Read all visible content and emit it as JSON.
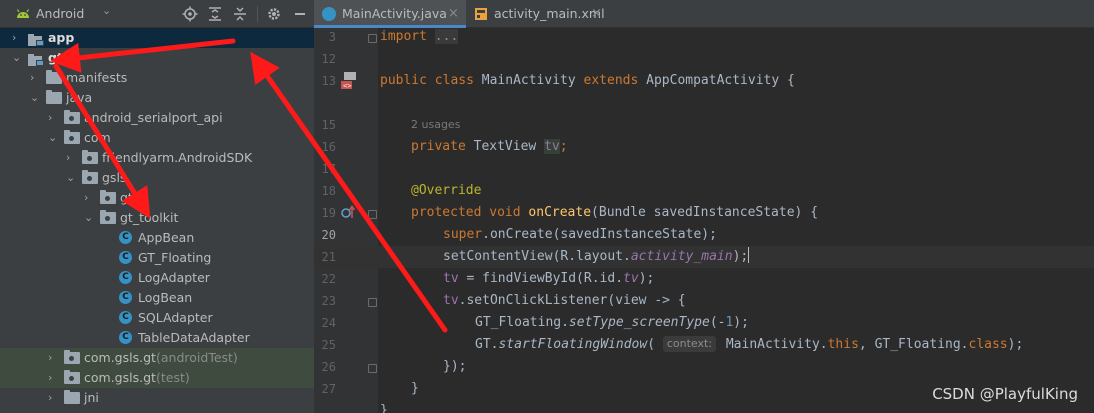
{
  "project_panel": {
    "view_name": "Android",
    "tree": [
      {
        "label": "app",
        "bold": true,
        "arrow": "›",
        "indent": 0,
        "icon": "module-icon",
        "selected": true
      },
      {
        "label": "gt",
        "bold": true,
        "arrow": "⌄",
        "indent": 0,
        "icon": "module-icon"
      },
      {
        "label": "manifests",
        "arrow": "›",
        "indent": 1,
        "icon": "folder-icon"
      },
      {
        "label": "java",
        "arrow": "⌄",
        "indent": 1,
        "icon": "folder-icon"
      },
      {
        "label": "android_serialport_api",
        "arrow": "›",
        "indent": 2,
        "icon": "package-icon"
      },
      {
        "label": "com",
        "arrow": "⌄",
        "indent": 2,
        "icon": "package-icon"
      },
      {
        "label": "friendlyarm.AndroidSDK",
        "arrow": "›",
        "indent": 3,
        "icon": "package-icon"
      },
      {
        "label": "gsls",
        "arrow": "⌄",
        "indent": 3,
        "icon": "package-icon"
      },
      {
        "label": "gt",
        "arrow": "›",
        "indent": 4,
        "icon": "package-icon"
      },
      {
        "label": "gt_toolkit",
        "arrow": "⌄",
        "indent": 4,
        "icon": "package-icon"
      },
      {
        "label": "AppBean",
        "indent": 5,
        "icon": "class-icon"
      },
      {
        "label": "GT_Floating",
        "indent": 5,
        "icon": "class-icon"
      },
      {
        "label": "LogAdapter",
        "indent": 5,
        "icon": "class-icon"
      },
      {
        "label": "LogBean",
        "indent": 5,
        "icon": "class-icon"
      },
      {
        "label": "SQLAdapter",
        "indent": 5,
        "icon": "class-icon"
      },
      {
        "label": "TableDataAdapter",
        "indent": 5,
        "icon": "class-icon"
      },
      {
        "label": "com.gsls.gt",
        "suffix": " (androidTest)",
        "arrow": "›",
        "indent": 2,
        "icon": "package-icon",
        "test": true
      },
      {
        "label": "com.gsls.gt",
        "suffix": " (test)",
        "arrow": "›",
        "indent": 2,
        "icon": "package-icon",
        "test": true
      },
      {
        "label": "jni",
        "arrow": "›",
        "indent": 2,
        "icon": "folder-icon"
      }
    ]
  },
  "tabs": [
    {
      "label": "MainActivity.java",
      "active": true,
      "icon_color": "#3592c4",
      "icon_glyph": "C"
    },
    {
      "label": "activity_main.xml",
      "active": false,
      "icon_color": "#e8a33d",
      "icon_glyph": ""
    }
  ],
  "code": {
    "line_numbers": [
      "3",
      "12",
      "13",
      "",
      "15",
      "16",
      "17",
      "18",
      "19",
      "20",
      "21",
      "22",
      "23",
      "24",
      "25",
      "26",
      "27"
    ],
    "current_line": "20",
    "usages": "2 usages",
    "tokens": {
      "import": "import",
      "import_fold": "...",
      "public": "public",
      "class": "class",
      "MainActivity": "MainActivity",
      "extends": "extends",
      "AppCompatActivity": "AppCompatActivity",
      "brace_open": "{",
      "private": "private",
      "TextView": "TextView",
      "tv": "tv",
      "semicolon": ";",
      "override": "@Override",
      "protected": "protected",
      "void": "void",
      "onCreate": "onCreate",
      "params": "(Bundle savedInstanceState) {",
      "super": "super",
      "super_call": ".onCreate(savedInstanceState);",
      "setContentView": "setContentView(R.layout.",
      "activity_main": "activity_main",
      "close_paren_semi": ");",
      "tv_assign": " = findViewById(R.id.",
      "tv_id": "tv",
      "set_listener": ".setOnClickListener(view -> {",
      "gt_floating": "GT_Floating.",
      "setType": "setType_screenType",
      "neg_one_open": "(-",
      "one": "1",
      "gt_prefix": "GT.",
      "startFloating": "startFloatingWindow",
      "open_paren": "(",
      "hint_context": "context:",
      "main_this": " MainActivity.",
      "this": "this",
      "gt_floating_arg": ", GT_Floating.",
      "class_kw": "class",
      "close_block": "});",
      "close_brace": "}"
    }
  },
  "watermark": "CSDN @PlayfulKing",
  "colors": {
    "accent": "#4a88c7",
    "arrow": "#ff0000",
    "panel_bg": "#3c3f41",
    "editor_bg": "#2b2b2b"
  }
}
